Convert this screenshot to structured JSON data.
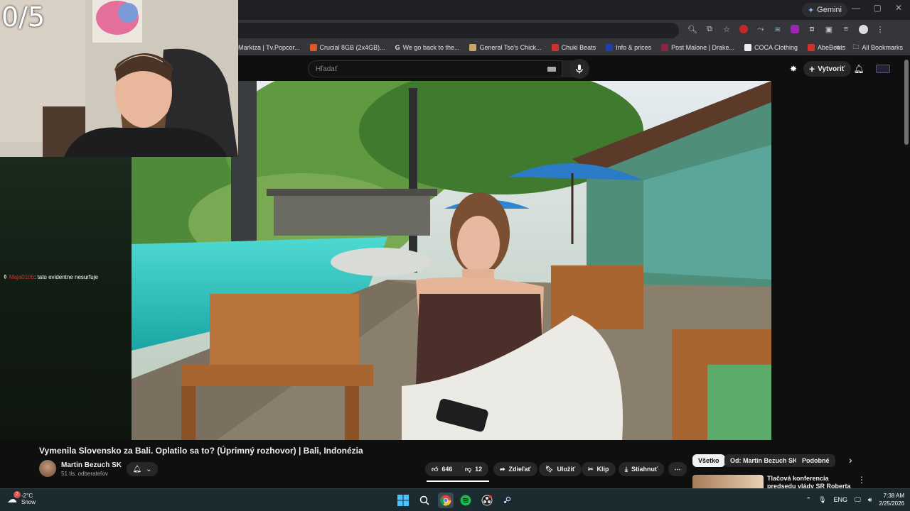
{
  "overlay": {
    "counter": "0/5"
  },
  "browser": {
    "gemini_label": "Gemini",
    "bookmarks": [
      {
        "label": "Markíza | Tv.Popcor...",
        "color": "#e4a23b"
      },
      {
        "label": "Crucial 8GB (2x4GB)...",
        "color": "#e2562b"
      },
      {
        "label": "We go back to the...",
        "color": "#4285f4"
      },
      {
        "label": "General Tso's Chick...",
        "color": "#c9a66b"
      },
      {
        "label": "Chuki Beats",
        "color": "#d32f2f"
      },
      {
        "label": "Info & prices",
        "color": "#1e40af"
      },
      {
        "label": "Post Malone | Drake...",
        "color": "#8e2441"
      },
      {
        "label": "COCA Clothing",
        "color": "#222222"
      },
      {
        "label": "AbeBeats",
        "color": "#d32f2f"
      }
    ],
    "all_bookmarks": "All Bookmarks"
  },
  "youtube": {
    "search_placeholder": "Hľadať",
    "create_label": "Vytvoriť",
    "video_title": "Vymenila Slovensko za Bali. Oplatilo sa to? (Úprimný rozhovor) | Bali, Indonézia",
    "channel_name": "Martin Bezuch SK",
    "subscribers": "51 tis. odberateľov",
    "likes": "646",
    "dislikes": "12",
    "share": "Zdieľať",
    "save": "Uložiť",
    "clip": "Klip",
    "download": "Stiahnuť",
    "chips": [
      "Všetko",
      "Od: Martin Bezuch SK",
      "Podobné"
    ],
    "rec_title": "Tlačová konferencia predsedu vlády SR Roberta Fica po"
  },
  "chat": {
    "username": "Maja0105",
    "message": ": tato evidentne nesurfuje"
  },
  "taskbar": {
    "temp": "-2°C",
    "condition": "Snow",
    "lang": "ENG",
    "time": "7:38 AM",
    "date": "2/25/2026",
    "badge": "2"
  }
}
